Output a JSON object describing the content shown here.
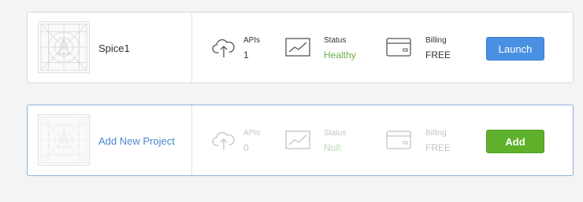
{
  "projects": [
    {
      "name": "Spice1",
      "apis_label": "APIs",
      "apis_value": "1",
      "status_label": "Status",
      "status_value": "Healthy",
      "billing_label": "Billing",
      "billing_value": "FREE",
      "button_label": "Launch"
    },
    {
      "name": "Add New Project",
      "apis_label": "APIs",
      "apis_value": "0",
      "status_label": "Status",
      "status_value": "Null;",
      "billing_label": "Billing",
      "billing_value": "FREE",
      "button_label": "Add"
    }
  ],
  "colors": {
    "launch": "#4a90e2",
    "add": "#5fb12c",
    "healthy": "#6aae4a",
    "link": "#4a86cc"
  },
  "icons": {
    "apis": "cloud-upload-icon",
    "status": "chart-icon",
    "billing": "credit-card-icon",
    "thumbnail": "project-placeholder-icon"
  }
}
